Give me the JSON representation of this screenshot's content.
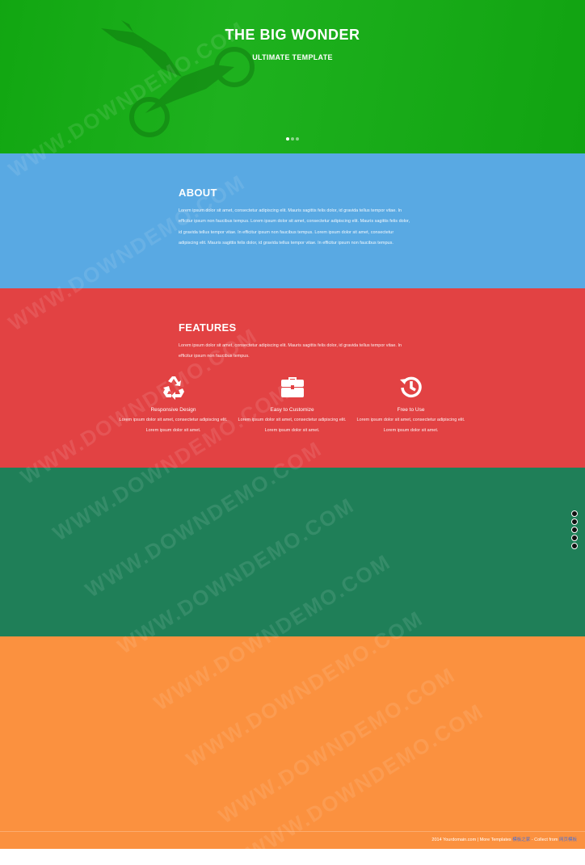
{
  "hero": {
    "title": "THE BIG WONDER",
    "subtitle": "ULTIMATE TEMPLATE",
    "slider_dots": 3,
    "active_dot": 0
  },
  "about": {
    "heading": "ABOUT",
    "text": "Lorem ipsum dolor sit amet, consectetur adipiscing elit. Mauris sagittis felis dolor, id gravida tellus tempor vitae. In efficitur ipsum non faucibus tempus. Lorem ipsum dolor sit amet, consectetur adipiscing elit. Mauris sagittis felis dolor, id gravida tellus tempor vitae. In efficitur ipsum non faucibus tempus. Lorem ipsum dolor sit amet, consectetur adipiscing elit. Mauris sagittis felis dolor, id gravida tellus tempor vitae. In efficitur ipsum non faucibus tempus."
  },
  "features": {
    "heading": "FEATURES",
    "text": "Lorem ipsum dolor sit amet, consectetur adipiscing elit. Mauris sagittis felis dolor, id gravida tellus tempor vitae. In efficitur ipsum non faucibus tempus.",
    "items": [
      {
        "icon": "recycle-icon",
        "title": "Responsive Design",
        "text": "Lorem ipsum dolor sit amet, consectetur adipiscing elit. Lorem ipsum dolor sit amet."
      },
      {
        "icon": "briefcase-icon",
        "title": "Easy to Customize",
        "text": "Lorem ipsum dolor sit amet, consectetur adipiscing elit. Lorem ipsum dolor sit amet."
      },
      {
        "icon": "history-icon",
        "title": "Free to Use",
        "text": "Lorem ipsum dolor sit amet, consectetur adipiscing elit. Lorem ipsum dolor sit amet."
      }
    ]
  },
  "side_nav": {
    "count": 5
  },
  "footer": {
    "copyright": "2014 Yourdomain.com | More Templates",
    "more_link": "模板之家",
    "collect_label": "- Collect from",
    "collect_link": "网页模板"
  },
  "watermark": "WWW.DOWNDEMO.COM",
  "colors": {
    "hero_bg": "#12ad12",
    "about_bg": "#59a9e3",
    "features_bg": "#e24243",
    "green_bg": "#1f7f58",
    "orange_bg": "#fb913f"
  }
}
